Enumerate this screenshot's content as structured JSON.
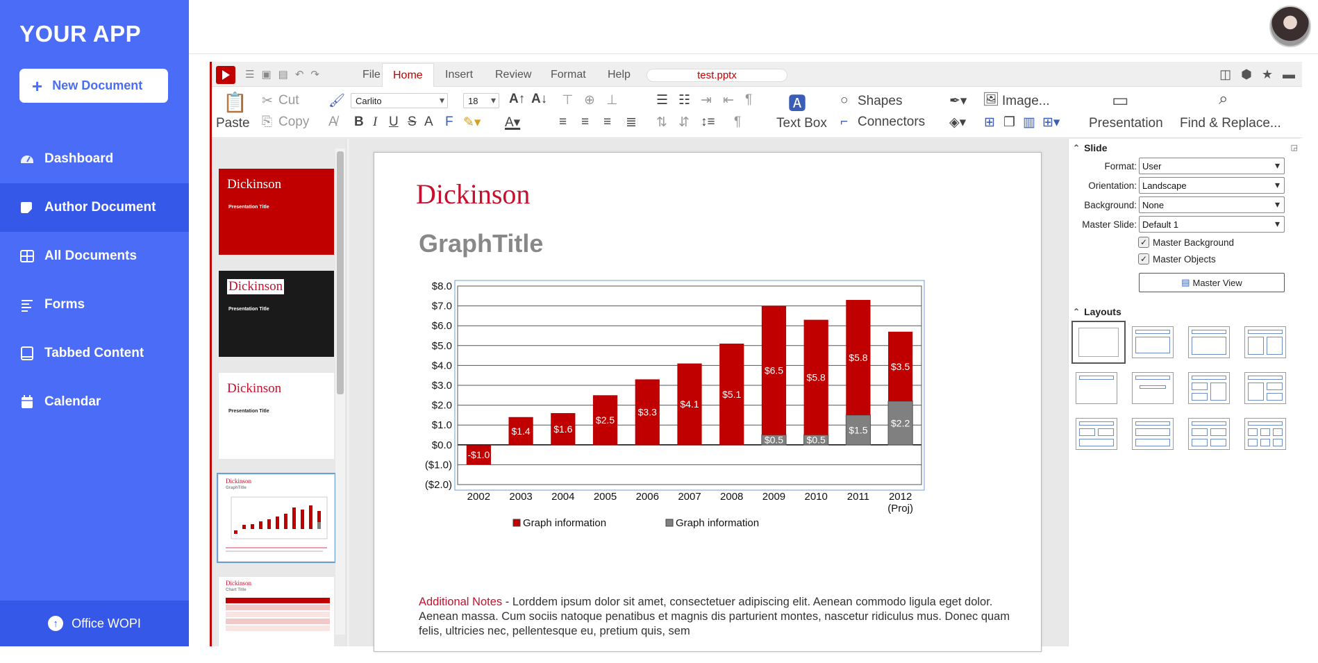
{
  "sidebar": {
    "brand": "YOUR APP",
    "new_doc": "New Document",
    "items": [
      {
        "label": "Dashboard",
        "icon": "dashboard-icon"
      },
      {
        "label": "Author Document",
        "icon": "edit-icon"
      },
      {
        "label": "All Documents",
        "icon": "grid-icon"
      },
      {
        "label": "Forms",
        "icon": "list-icon"
      },
      {
        "label": "Tabbed Content",
        "icon": "tablet-icon"
      },
      {
        "label": "Calendar",
        "icon": "calendar-icon"
      }
    ],
    "footer": "Office WOPI"
  },
  "office": {
    "menus": [
      "File",
      "Home",
      "Insert",
      "Review",
      "Format",
      "Help"
    ],
    "active_menu": "Home",
    "filename": "test.pptx",
    "ribbon": {
      "paste": "Paste",
      "cut": "Cut",
      "copy": "Copy",
      "font": "Carlito",
      "size": "18",
      "text_box": "Text Box",
      "shapes": "Shapes",
      "connectors": "Connectors",
      "image": "Image...",
      "presentation": "Presentation",
      "find": "Find & Replace..."
    }
  },
  "slide": {
    "logo": "Dickinson",
    "title": "GraphTitle",
    "notes_lead": "Additional Notes",
    "notes_text": " - Lorddem ipsum dolor sit amet, consectetuer adipiscing elit. Aenean commodo ligula eget dolor. Aenean massa. Cum sociis natoque penatibus et magnis dis parturient montes, nascetur ridiculus mus. Donec quam felis, ultricies nec, pellentesque eu, pretium quis, sem"
  },
  "thumbs": [
    {
      "title": "Dickinson",
      "sub": "Presentation Title"
    },
    {
      "title": "Dickinson",
      "sub": "Presentation Title"
    },
    {
      "title": "Dickinson",
      "sub": "Presentation Title"
    },
    {
      "title": "Dickinson",
      "sub": "GraphTitle"
    },
    {
      "title": "Dickinson",
      "sub": "Chart Title"
    }
  ],
  "panel": {
    "slide_head": "Slide",
    "format_label": "Format:",
    "format_value": "User",
    "orientation_label": "Orientation:",
    "orientation_value": "Landscape",
    "background_label": "Background:",
    "background_value": "None",
    "master_label": "Master Slide:",
    "master_value": "Default 1",
    "chk_bg": "Master Background",
    "chk_obj": "Master Objects",
    "master_view": "Master View",
    "layouts_head": "Layouts"
  },
  "colors": {
    "brand": "#4a6cf7",
    "accent": "#c00000",
    "bar_red": "#c00000",
    "bar_gray": "#808080"
  },
  "chart_data": {
    "type": "bar",
    "categories": [
      "2002",
      "2003",
      "2004",
      "2005",
      "2006",
      "2007",
      "2008",
      "2009",
      "2010",
      "2011",
      "2012\n(Proj)"
    ],
    "category_labels": [
      "2002",
      "2003",
      "2004",
      "2005",
      "2006",
      "2007",
      "2008",
      "2009",
      "2010",
      "2011",
      "2012"
    ],
    "category_sublabels": [
      "",
      "",
      "",
      "",
      "",
      "",
      "",
      "",
      "",
      "",
      "(Proj)"
    ],
    "series": [
      {
        "name": "Graph information",
        "color": "#c00000",
        "values": [
          -1.0,
          1.4,
          1.6,
          2.5,
          3.3,
          4.1,
          5.1,
          6.5,
          5.8,
          5.8,
          3.5
        ],
        "labels": [
          "-$1.0",
          "$1.4",
          "$1.6",
          "$2.5",
          "$3.3",
          "$4.1",
          "$5.1",
          "$6.5",
          "$5.8",
          "$5.8",
          "$3.5"
        ]
      },
      {
        "name": "Graph information",
        "color": "#808080",
        "values": [
          0,
          0,
          0,
          0,
          0,
          0,
          0,
          0.5,
          0.5,
          1.5,
          2.2
        ],
        "labels": [
          "",
          "",
          "",
          "",
          "",
          "",
          "",
          "$0.5",
          "$0.5",
          "$1.5",
          "$2.2"
        ]
      }
    ],
    "stacked": true,
    "ylim": [
      -2,
      8
    ],
    "yticks": [
      "$8.0",
      "$7.0",
      "$6.0",
      "$5.0",
      "$4.0",
      "$3.0",
      "$2.0",
      "$1.0",
      "$0.0",
      "($1.0)",
      "($2.0)"
    ],
    "grid": true,
    "legend": "bottom"
  }
}
